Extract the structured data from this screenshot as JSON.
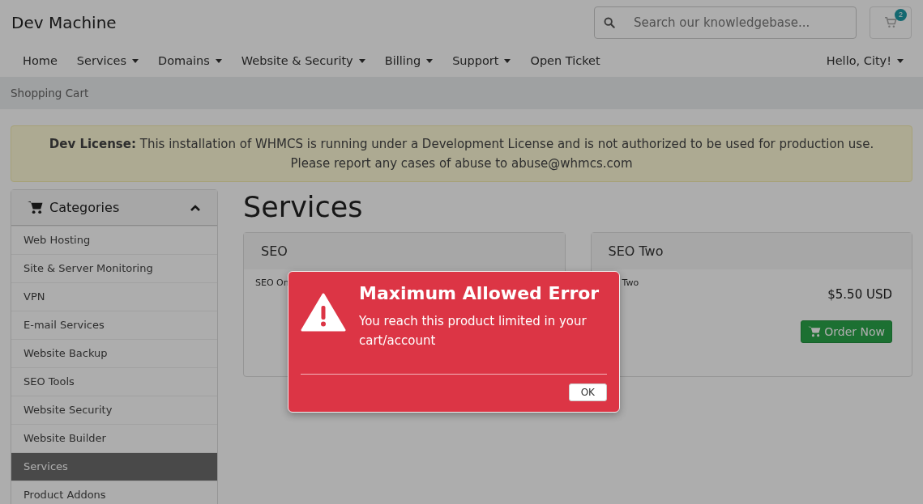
{
  "brand": "Dev Machine",
  "search": {
    "placeholder": "Search our knowledgebase..."
  },
  "cart": {
    "count": "2"
  },
  "nav": [
    {
      "label": "Home",
      "dropdown": false
    },
    {
      "label": "Services",
      "dropdown": true
    },
    {
      "label": "Domains",
      "dropdown": true
    },
    {
      "label": "Website & Security",
      "dropdown": true
    },
    {
      "label": "Billing",
      "dropdown": true
    },
    {
      "label": "Support",
      "dropdown": true
    },
    {
      "label": "Open Ticket",
      "dropdown": false
    }
  ],
  "user_menu": {
    "label": "Hello, City!",
    "dropdown": true
  },
  "breadcrumb": "Shopping Cart",
  "license_notice": {
    "lines": [
      "**Dev License:** This installation of WHMCS is running under a Development License and is not authorized to be used for production use.",
      "Please report any cases of abuse to abuse@whmcs.com"
    ]
  },
  "sidebar": {
    "title": "Categories",
    "expanded": true,
    "items": [
      {
        "label": "Web Hosting",
        "selected": false
      },
      {
        "label": "Site & Server Monitoring",
        "selected": false
      },
      {
        "label": "VPN",
        "selected": false
      },
      {
        "label": "E-mail Services",
        "selected": false
      },
      {
        "label": "Website Backup",
        "selected": false
      },
      {
        "label": "SEO Tools",
        "selected": false
      },
      {
        "label": "Website Security",
        "selected": false
      },
      {
        "label": "Website Builder",
        "selected": false
      },
      {
        "label": "Services",
        "selected": true
      },
      {
        "label": "Product Addons",
        "selected": false
      }
    ]
  },
  "heading": "Services",
  "products": [
    {
      "name": "SEO",
      "description": "SEO On"
    },
    {
      "name": "SEO Two",
      "description": "Two",
      "price": "$5.50 USD",
      "button": "Order Now"
    }
  ],
  "modal": {
    "title": "Maximum Allowed Error",
    "message": "You reach this product limited in your cart/account",
    "button": "OK"
  }
}
